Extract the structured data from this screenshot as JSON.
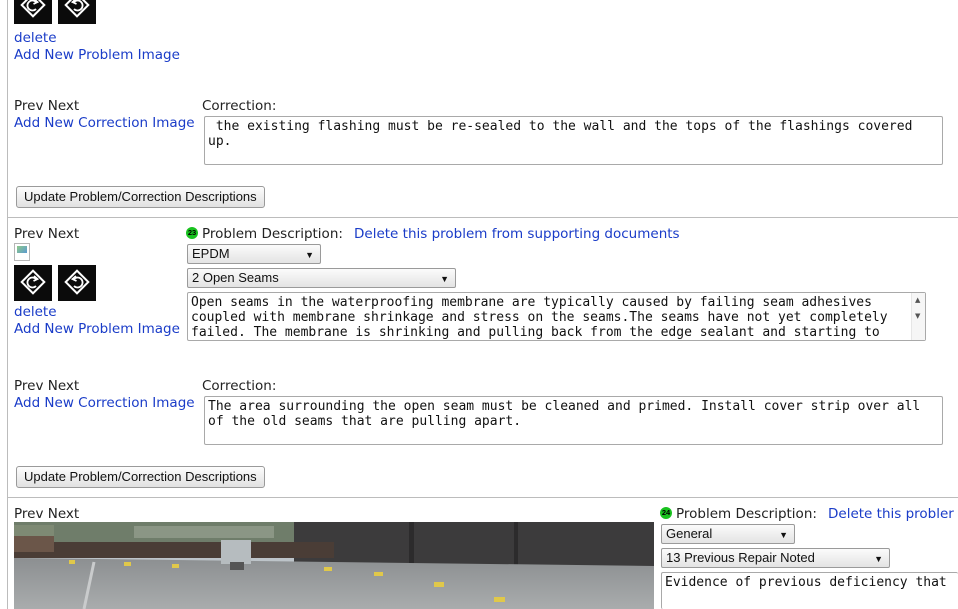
{
  "block1": {
    "delete_label": "delete",
    "add_problem_image": "Add New Problem Image",
    "prev": "Prev",
    "next": "Next",
    "correction_label": "Correction:",
    "add_correction_image": "Add New Correction Image",
    "correction_text": " the existing flashing must be re-sealed to the wall and the tops of the flashings covered up.",
    "update_button": "Update Problem/Correction Descriptions"
  },
  "block2": {
    "prev": "Prev",
    "next": "Next",
    "badge": "23",
    "problem_label": "Problem Description:",
    "delete_problem_link": "Delete this problem from supporting documents",
    "category_select": "EPDM",
    "problem_select": "2 Open Seams",
    "problem_text": "Open seams in the waterproofing membrane are typically caused by failing seam adhesives coupled with membrane shrinkage and stress on the seams.The seams have not yet completely failed. The membrane is shrinking and pulling back from the edge sealant and starting to",
    "delete_label": "delete",
    "add_problem_image": "Add New Problem Image",
    "prev2": "Prev",
    "next2": "Next",
    "correction_label": "Correction:",
    "add_correction_image": "Add New Correction Image",
    "correction_text": "The area surrounding the open seam must be cleaned and primed. Install cover strip over all of the old seams that are pulling apart.",
    "update_button": "Update Problem/Correction Descriptions"
  },
  "block3": {
    "prev": "Prev",
    "next": "Next",
    "badge": "24",
    "problem_label": "Problem Description:",
    "delete_problem_link": "Delete this probler",
    "category_select": "General",
    "problem_select": "13 Previous Repair Noted",
    "problem_text": "Evidence of previous deficiency that"
  },
  "icons": {
    "rotate_left": "rotate-left-icon",
    "rotate_right": "rotate-right-icon"
  }
}
